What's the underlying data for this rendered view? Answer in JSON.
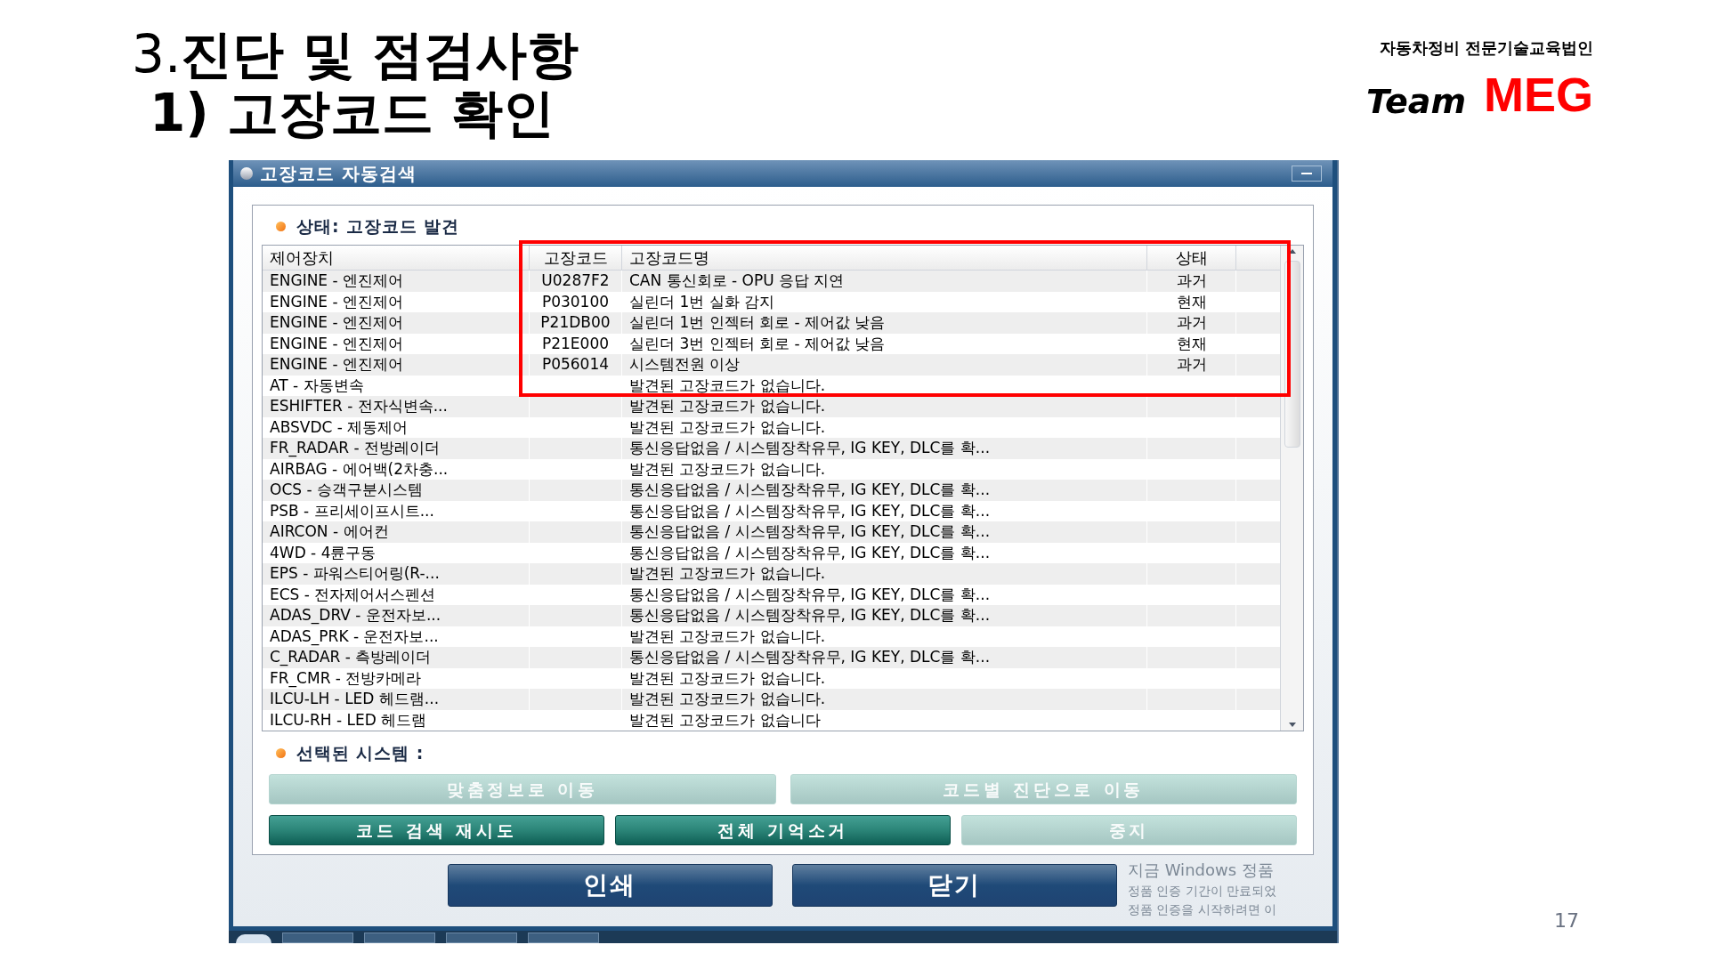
{
  "slide": {
    "title_lines": [
      "3.**진단 및 점검사항**",
      "**1) 고장코드 확인**"
    ],
    "org": "자동차정비 전문기술교육법인",
    "logo": {
      "word_1": "Team",
      "word_2": "MEG"
    },
    "page_number": "17"
  },
  "window": {
    "title": "고장코드 자동검색",
    "status": "상태: 고장코드 발견",
    "table": {
      "columns": [
        "제어장치",
        "고장코드",
        "고장코드명",
        "상태"
      ],
      "rows": [
        {
          "cells": [
            "ENGINE - 엔진제어",
            "U0287F2",
            "CAN 통신회로 - OPU 응답 지연",
            "과거"
          ]
        },
        {
          "cells": [
            "ENGINE - 엔진제어",
            "P030100",
            "실린더 1번 실화 감지",
            "현재"
          ]
        },
        {
          "cells": [
            "ENGINE - 엔진제어",
            "P21DB00",
            "실린더 1번 인젝터 회로 - 제어값 낮음",
            "과거"
          ]
        },
        {
          "cells": [
            "ENGINE - 엔진제어",
            "P21E000",
            "실린더 3번 인젝터 회로 - 제어값 낮음",
            "현재"
          ]
        },
        {
          "cells": [
            "ENGINE - 엔진제어",
            "P056014",
            "시스템전원 이상",
            "과거"
          ]
        },
        {
          "cells": [
            "AT - 자동변속",
            "",
            "발견된 고장코드가 없습니다.",
            ""
          ]
        },
        {
          "cells": [
            "ESHIFTER - 전자식변속...",
            "",
            "발견된 고장코드가 없습니다.",
            ""
          ]
        },
        {
          "cells": [
            "ABSVDC - 제동제어",
            "",
            "발견된 고장코드가 없습니다.",
            ""
          ]
        },
        {
          "cells": [
            "FR_RADAR - 전방레이더",
            "",
            "통신응답없음 / 시스템장착유무, IG KEY, DLC를 확...",
            ""
          ]
        },
        {
          "cells": [
            "AIRBAG - 에어백(2차충...",
            "",
            "발견된 고장코드가 없습니다.",
            ""
          ]
        },
        {
          "cells": [
            "OCS - 승객구분시스템",
            "",
            "통신응답없음 / 시스템장착유무, IG KEY, DLC를 확...",
            ""
          ]
        },
        {
          "cells": [
            "PSB - 프리세이프시트...",
            "",
            "통신응답없음 / 시스템장착유무, IG KEY, DLC를 확...",
            ""
          ]
        },
        {
          "cells": [
            "AIRCON - 에어컨",
            "",
            "통신응답없음 / 시스템장착유무, IG KEY, DLC를 확...",
            ""
          ]
        },
        {
          "cells": [
            "4WD - 4륜구동",
            "",
            "통신응답없음 / 시스템장착유무, IG KEY, DLC를 확...",
            ""
          ]
        },
        {
          "cells": [
            "EPS - 파워스티어링(R-...",
            "",
            "발견된 고장코드가 없습니다.",
            ""
          ]
        },
        {
          "cells": [
            "ECS - 전자제어서스펜션",
            "",
            "통신응답없음 / 시스템장착유무, IG KEY, DLC를 확...",
            ""
          ]
        },
        {
          "cells": [
            "ADAS_DRV - 운전자보...",
            "",
            "통신응답없음 / 시스템장착유무, IG KEY, DLC를 확...",
            ""
          ]
        },
        {
          "cells": [
            "ADAS_PRK - 운전자보...",
            "",
            "발견된 고장코드가 없습니다.",
            ""
          ]
        },
        {
          "cells": [
            "C_RADAR - 측방레이더",
            "",
            "통신응답없음 / 시스템장착유무, IG KEY, DLC를 확...",
            ""
          ]
        },
        {
          "cells": [
            "FR_CMR - 전방카메라",
            "",
            "발견된 고장코드가 없습니다.",
            ""
          ]
        },
        {
          "cells": [
            "ILCU-LH - LED 헤드램...",
            "",
            "발견된 고장코드가 없습니다.",
            ""
          ]
        },
        {
          "cells": [
            "ILCU-RH - LED 헤드램",
            "",
            "발견된 고장코드가 없습니다",
            ""
          ]
        }
      ]
    },
    "selected_system_label": "선택된 시스템 :",
    "buttons_row_1": [
      {
        "label": "맞춤정보로 이동",
        "disabled": true
      },
      {
        "label": "코드별 진단으로 이동",
        "disabled": true
      }
    ],
    "buttons_row_2": [
      {
        "label": "코드 검색 재시도",
        "disabled": false
      },
      {
        "label": "전체 기억소거",
        "disabled": false
      },
      {
        "label": "중지",
        "disabled": true
      }
    ],
    "footer_buttons": [
      "인쇄",
      "닫기"
    ],
    "activation_notice": [
      "지금 Windows 정품",
      "정품 인증 기간이 만료되었",
      "정품 인증을 시작하려면 이"
    ]
  }
}
